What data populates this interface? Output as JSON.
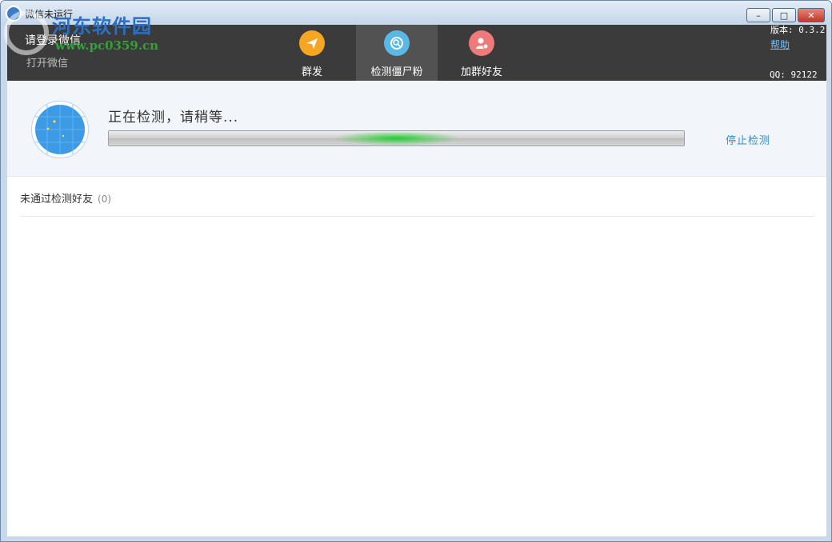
{
  "window": {
    "title": "微信未运行",
    "controls": {
      "minimize": "–",
      "restore": "□",
      "close": "✕"
    }
  },
  "toolbar": {
    "login_main": "请登录微信",
    "login_sub": "打开微信",
    "version": "版本: 0.3.2",
    "help": "帮助",
    "qq": "QQ: 92122",
    "tabs": [
      {
        "label": "群发",
        "icon": "send-icon",
        "color": "#f5a623"
      },
      {
        "label": "检测僵尸粉",
        "icon": "detect-icon",
        "color": "#5ab8e6",
        "active": true
      },
      {
        "label": "加群好友",
        "icon": "add-friend-icon",
        "color": "#f07a7a"
      }
    ]
  },
  "watermark": {
    "line1": "河东软件园",
    "line2": "www.pc0359.cn"
  },
  "detection": {
    "status": "正在检测，请稍等...",
    "stop_label": "停止检测",
    "progress_indicator_position": 0.39
  },
  "list": {
    "header": "未通过检测好友",
    "count": "(0)"
  }
}
